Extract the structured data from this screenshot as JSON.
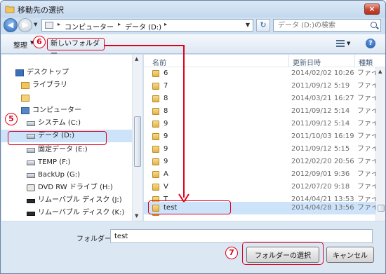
{
  "window": {
    "title": "移動先の選択",
    "close_glyph": "×"
  },
  "address_bar": {
    "crumbs": [
      "コンピューター",
      "データ (D:)"
    ],
    "search_placeholder": "データ (D:)の検索",
    "back_glyph": "◀",
    "forward_glyph": "▶",
    "refresh_glyph": "↻"
  },
  "toolbar": {
    "organize_label": "整理",
    "new_folder_label": "新しいフォルダー",
    "help_glyph": "?"
  },
  "annotations": {
    "step5": "5",
    "step6": "6",
    "step7": "7"
  },
  "nav_pane": {
    "items": [
      {
        "label": "デスクトップ",
        "icon": "desktop-icon"
      },
      {
        "label": "ライブラリ",
        "icon": "library-icon"
      },
      {
        "label": "",
        "icon": "user-folder-icon"
      },
      {
        "label": "コンピューター",
        "icon": "computer-icon"
      },
      {
        "label": "システム (C:)",
        "icon": "drive-icon"
      },
      {
        "label": "データ (D:)",
        "icon": "drive-icon"
      },
      {
        "label": "固定データ (E:)",
        "icon": "drive-icon"
      },
      {
        "label": "TEMP (F:)",
        "icon": "drive-icon"
      },
      {
        "label": "BackUp (G:)",
        "icon": "drive-icon"
      },
      {
        "label": "DVD RW ドライブ (H:)",
        "icon": "dvd-icon"
      },
      {
        "label": "リムーバブル ディスク (J:)",
        "icon": "removable-icon"
      },
      {
        "label": "リムーバブル ディスク (K:)",
        "icon": "removable-icon"
      }
    ]
  },
  "file_list": {
    "columns": {
      "name": "名前",
      "date": "更新日時",
      "type": "種類"
    },
    "rows": [
      {
        "name": "6",
        "date": "2014/02/02 10:26",
        "type": "ファイ"
      },
      {
        "name": "7",
        "date": "2011/09/12 5:19",
        "type": "ファイ"
      },
      {
        "name": "8",
        "date": "2014/03/21 16:27",
        "type": "ファイ"
      },
      {
        "name": "8",
        "date": "2011/09/12 5:14",
        "type": "ファイ"
      },
      {
        "name": "9",
        "date": "2011/09/12 5:14",
        "type": "ファイ"
      },
      {
        "name": "9",
        "date": "2011/10/03 16:19",
        "type": "ファイ"
      },
      {
        "name": "9",
        "date": "2011/09/12 5:15",
        "type": "ファイ"
      },
      {
        "name": "9",
        "date": "2012/02/20 20:56",
        "type": "ファイ"
      },
      {
        "name": "A",
        "date": "2012/09/01 9:36",
        "type": "ファイ"
      },
      {
        "name": "V",
        "date": "2012/07/20 9:18",
        "type": "ファイ"
      },
      {
        "name": "T",
        "date": "2014/04/21 13:53",
        "type": "ファイ"
      },
      {
        "name": "検",
        "date": "2012/07/11 8:04",
        "type": "ファイ"
      },
      {
        "name": "test",
        "date": "2014/04/28 13:56",
        "type": "ファイ"
      }
    ]
  },
  "bottom": {
    "folder_label": "フォルダー:",
    "folder_value": "test",
    "select_button": "フォルダーの選択",
    "cancel_button": "キャンセル"
  }
}
